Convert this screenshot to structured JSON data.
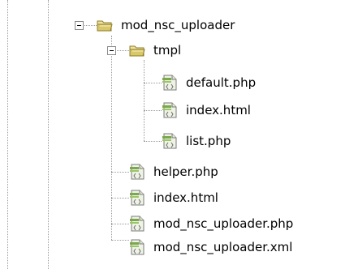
{
  "tree": {
    "nodes": [
      {
        "label": "mod_nsc_uploader",
        "type": "folder",
        "expanded": true
      },
      {
        "label": "tmpl",
        "type": "folder",
        "expanded": true
      },
      {
        "label": "default.php",
        "type": "file"
      },
      {
        "label": "index.html",
        "type": "file"
      },
      {
        "label": "list.php",
        "type": "file"
      },
      {
        "label": "helper.php",
        "type": "file"
      },
      {
        "label": "index.html",
        "type": "file"
      },
      {
        "label": "mod_nsc_uploader.php",
        "type": "file"
      },
      {
        "label": "mod_nsc_uploader.xml",
        "type": "file"
      }
    ]
  },
  "icons": {
    "folder": "open-folder-icon",
    "file": "php-file-icon"
  },
  "colors": {
    "folder": "#d8c86a",
    "file_accent": "#7aa84a",
    "guide": "#9a9a9a"
  }
}
